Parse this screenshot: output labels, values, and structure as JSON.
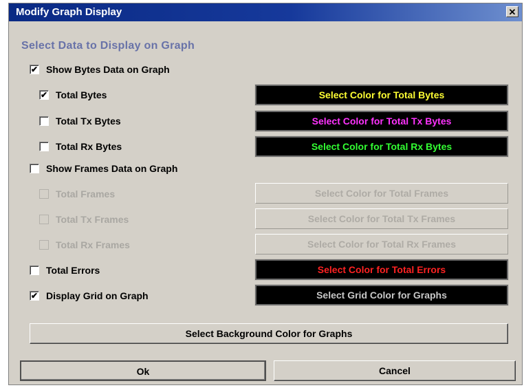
{
  "window": {
    "title": "Modify Graph Display",
    "close_label": "✕"
  },
  "section": {
    "title": "Select Data to Display on Graph"
  },
  "bytes": {
    "group_label": "Show Bytes Data on Graph",
    "group_checked": true,
    "items": [
      {
        "label": "Total Bytes",
        "checked": true,
        "button": "Select Color for Total Bytes",
        "color": "#ffff33"
      },
      {
        "label": "Total Tx Bytes",
        "checked": false,
        "button": "Select Color for Total Tx Bytes",
        "color": "#ff33ff"
      },
      {
        "label": "Total Rx Bytes",
        "checked": false,
        "button": "Select Color for Total Rx Bytes",
        "color": "#33ff33"
      }
    ]
  },
  "frames": {
    "group_label": "Show Frames Data on Graph",
    "group_checked": false,
    "items": [
      {
        "label": "Total Frames",
        "checked": false,
        "button": "Select Color for Total Frames"
      },
      {
        "label": "Total Tx Frames",
        "checked": false,
        "button": "Select Color for Total Tx Frames"
      },
      {
        "label": "Total Rx Frames",
        "checked": false,
        "button": "Select Color for Total Rx Frames"
      }
    ]
  },
  "errors": {
    "label": "Total Errors",
    "checked": false,
    "button": "Select Color for Total Errors",
    "color": "#ff2222"
  },
  "grid": {
    "label": "Display Grid on Graph",
    "checked": true,
    "button": "Select Grid Color for Graphs",
    "color": "#c8c8c8"
  },
  "background_button": "Select Background Color for Graphs",
  "footer": {
    "ok": "Ok",
    "cancel": "Cancel"
  },
  "checkmark": "✔"
}
